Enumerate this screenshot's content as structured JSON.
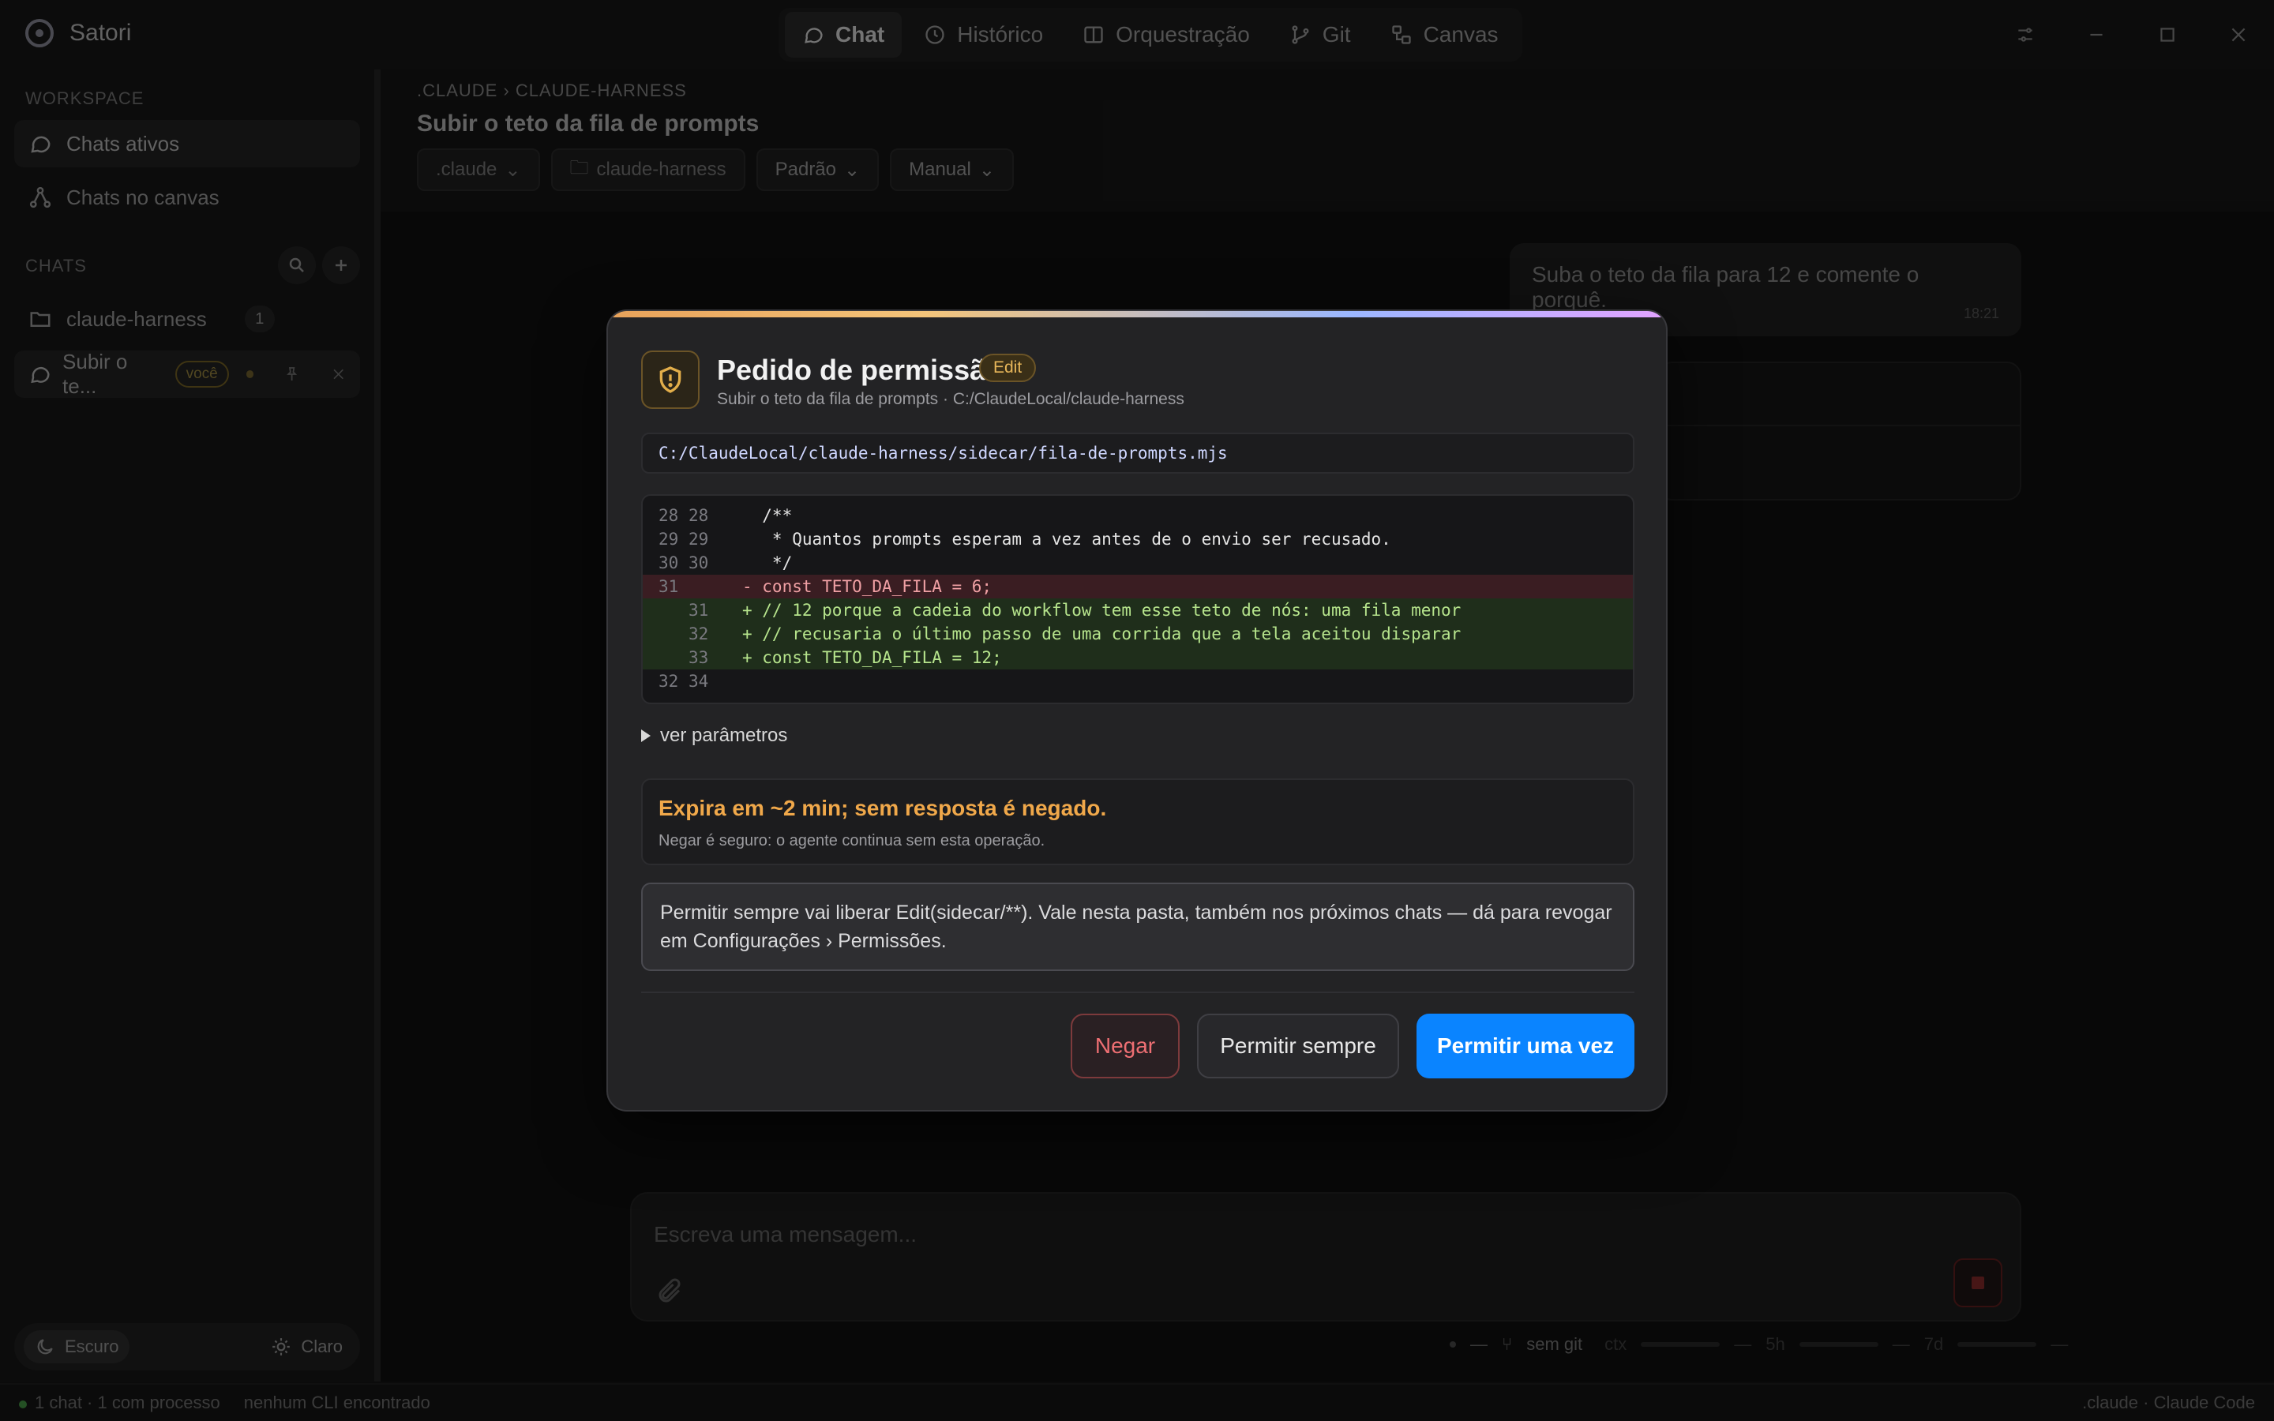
{
  "app": {
    "name": "Satori",
    "nav_tabs": [
      {
        "label": "Chat",
        "icon": "chat-bubble-icon",
        "active": true
      },
      {
        "label": "Histórico",
        "icon": "clock-icon",
        "active": false
      },
      {
        "label": "Orquestração",
        "icon": "layout-icon",
        "active": false
      },
      {
        "label": "Git",
        "icon": "git-branch-icon",
        "active": false
      },
      {
        "label": "Canvas",
        "icon": "canvas-icon",
        "active": false
      }
    ]
  },
  "sidebar": {
    "workspace_label": "WORKSPACE",
    "workspace_items": [
      {
        "label": "Chats ativos",
        "icon": "chat-bubble-icon",
        "active": true
      },
      {
        "label": "Chats no canvas",
        "icon": "graph-icon",
        "active": false
      }
    ],
    "chats_label": "CHATS",
    "folder": {
      "label": "claude-harness",
      "count": "1"
    },
    "active_chat": {
      "label": "Subir o te...",
      "badge": "você"
    },
    "theme": {
      "dark_label": "Escuro",
      "light_label": "Claro"
    }
  },
  "main": {
    "breadcrumb": ".CLAUDE  ›  CLAUDE-HARNESS",
    "title": "Subir o teto da fila de prompts",
    "chips": [
      ".claude",
      "claude-harness",
      "Padrão",
      "Manual"
    ],
    "user_message": {
      "text": "Suba o teto da fila para 12 e comente o porquê.",
      "time": "18:21"
    },
    "composer": {
      "placeholder": "Escreva uma mensagem..."
    },
    "statusline": {
      "dash": "—",
      "git": "sem git",
      "ctx": "ctx",
      "h5": "5h",
      "d7": "7d"
    }
  },
  "footer": {
    "left": [
      "1 chat · 1 com processo",
      "nenhum CLI encontrado"
    ],
    "right": ".claude · Claude Code"
  },
  "permission_dialog": {
    "title": "Pedido de permissão",
    "tool_badge": "Edit",
    "subtitle": "Subir o teto da fila de prompts · C:/ClaudeLocal/claude-harness",
    "file_path": "C:/ClaudeLocal/claude-harness/sidecar/fila-de-prompts.mjs",
    "diff": [
      {
        "old": "28",
        "new": "28",
        "kind": "ctx",
        "code": "  /**"
      },
      {
        "old": "29",
        "new": "29",
        "kind": "ctx",
        "code": "   * Quantos prompts esperam a vez antes de o envio ser recusado."
      },
      {
        "old": "30",
        "new": "30",
        "kind": "ctx",
        "code": "   */"
      },
      {
        "old": "31",
        "new": "",
        "kind": "del",
        "code": "- const TETO_DA_FILA = 6;"
      },
      {
        "old": "",
        "new": "31",
        "kind": "add",
        "code": "+ // 12 porque a cadeia do workflow tem esse teto de nós: uma fila menor"
      },
      {
        "old": "",
        "new": "32",
        "kind": "add",
        "code": "+ // recusaria o último passo de uma corrida que a tela aceitou disparar"
      },
      {
        "old": "",
        "new": "33",
        "kind": "add",
        "code": "+ const TETO_DA_FILA = 12;"
      },
      {
        "old": "32",
        "new": "34",
        "kind": "ctx",
        "code": ""
      }
    ],
    "params_toggle": "ver parâmetros",
    "expire_title": "Expira em ~2 min; sem resposta é negado.",
    "expire_note": "Negar é seguro: o agente continua sem esta operação.",
    "info_text": "Permitir sempre vai liberar Edit(sidecar/**). Vale nesta pasta, também nos próximos chats — dá para revogar em Configurações › Permissões.",
    "buttons": {
      "deny": "Negar",
      "always": "Permitir sempre",
      "once": "Permitir uma vez"
    },
    "colors": {
      "accent": "#0a84ff",
      "warning": "#f0a84a",
      "danger": "#ee6f73"
    }
  }
}
